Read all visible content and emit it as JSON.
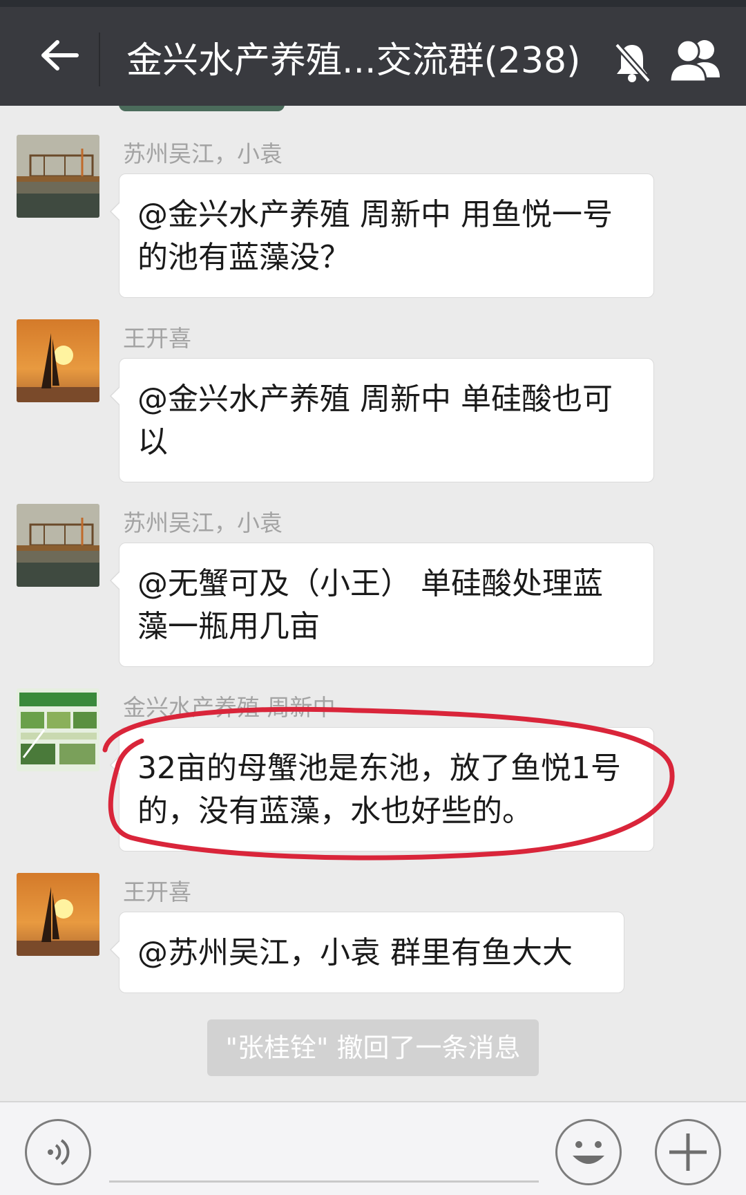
{
  "header": {
    "title": "金兴水产养殖...交流群(238)",
    "back_icon": "arrow-left-icon",
    "mute_icon": "bell-off-icon",
    "members_icon": "people-icon"
  },
  "messages": [
    {
      "sender": "苏州吴江，小袁",
      "avatar": "dock-crane-photo",
      "text": "@金兴水产养殖  周新中 用鱼悦一号的池有蓝藻没？"
    },
    {
      "sender": "王开喜",
      "avatar": "sunset-sailboat-photo",
      "text": "@金兴水产养殖  周新中 单硅酸也可以"
    },
    {
      "sender": "苏州吴江，小袁",
      "avatar": "dock-crane-photo",
      "text": "@无蟹可及（小王） 单硅酸处理蓝藻一瓶用几亩"
    },
    {
      "sender": "金兴水产养殖  周新中",
      "avatar": "poster-photo",
      "text": "32亩的母蟹池是东池，放了鱼悦1号的，没有蓝藻，水也好些的。"
    },
    {
      "sender": "王开喜",
      "avatar": "sunset-sailboat-photo",
      "text": "@苏州吴江，小袁 群里有鱼大大"
    }
  ],
  "recall_notice": "\"张桂铨\" 撤回了一条消息",
  "colors": {
    "header_bg": "#393a3f",
    "chat_bg": "#ebebeb",
    "annotation_red": "#d9253a"
  },
  "input_bar": {
    "voice_icon": "voice-icon",
    "emoji_icon": "smiley-icon",
    "plus_icon": "plus-icon",
    "input_value": ""
  }
}
